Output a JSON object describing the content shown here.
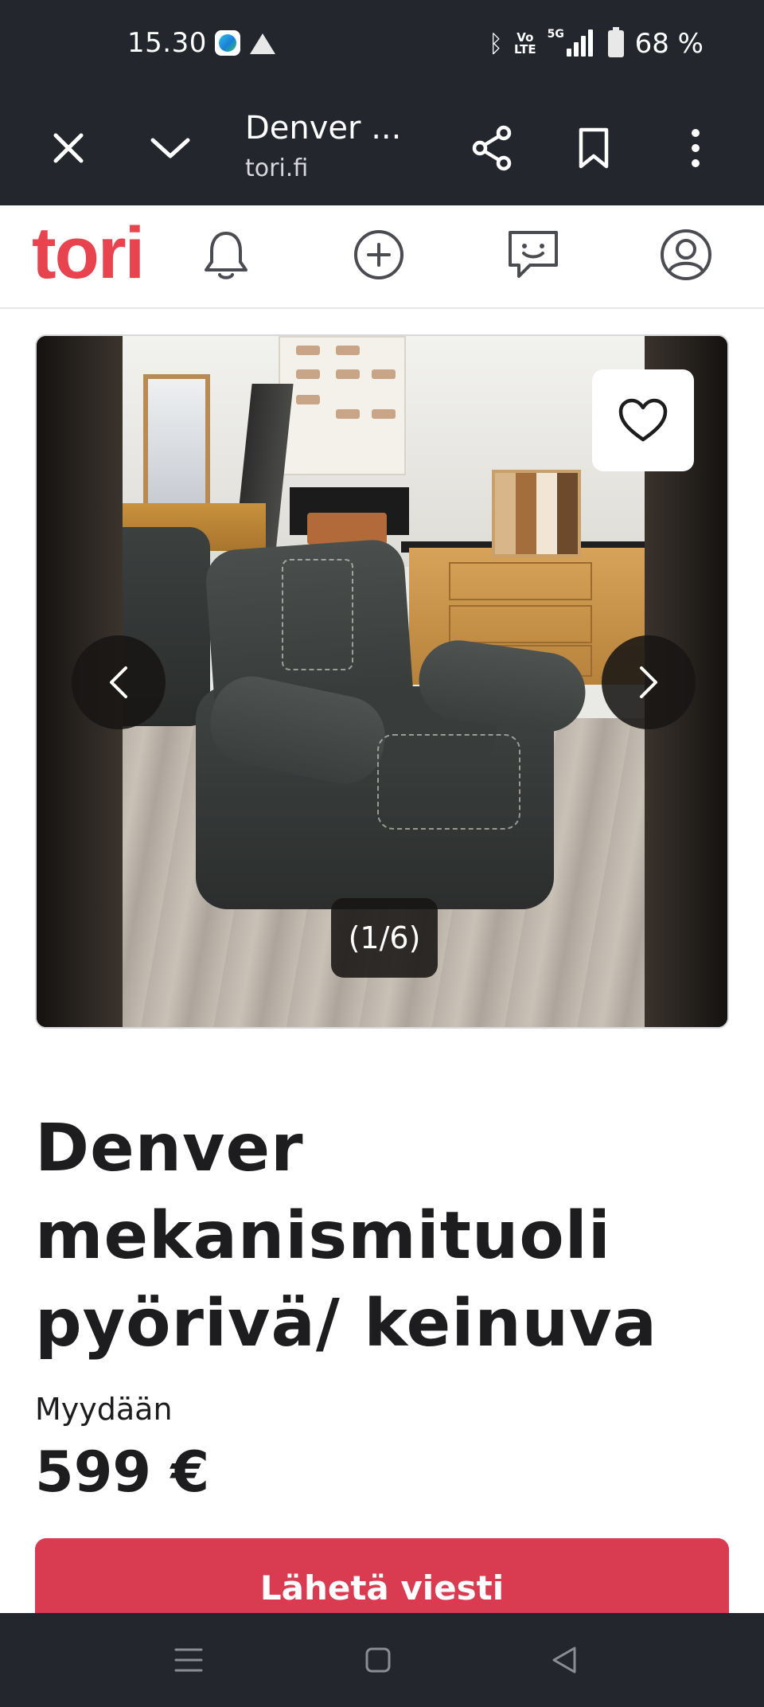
{
  "status_bar": {
    "time": "15.30",
    "volte_line1": "Vo",
    "volte_line2": "LTE",
    "network": "5G",
    "battery": "68 %"
  },
  "browser": {
    "page_title": "Denver ...",
    "domain": "tori.fi"
  },
  "site": {
    "logo": "tori",
    "brand_color": "#e8444f"
  },
  "gallery": {
    "counter": "(1/6)",
    "current_image": 1,
    "total_images": 6
  },
  "listing": {
    "title": "Denver mekanismituoli pyörivä/ keinuva",
    "sale_type": "Myydään",
    "price": "599 €"
  },
  "actions": {
    "send_message": "Lähetä viesti",
    "cta_color": "#d93b50"
  },
  "icons": {
    "toolbar": [
      "close-icon",
      "chevron-down-icon",
      "share-icon",
      "bookmark-icon",
      "more-vert-icon"
    ],
    "site_nav": [
      "bell-icon",
      "plus-circle-icon",
      "chat-icon",
      "profile-icon"
    ],
    "gallery": [
      "heart-icon",
      "chevron-left-icon",
      "chevron-right-icon"
    ],
    "system_nav": [
      "menu-icon",
      "home-icon",
      "back-icon"
    ]
  }
}
